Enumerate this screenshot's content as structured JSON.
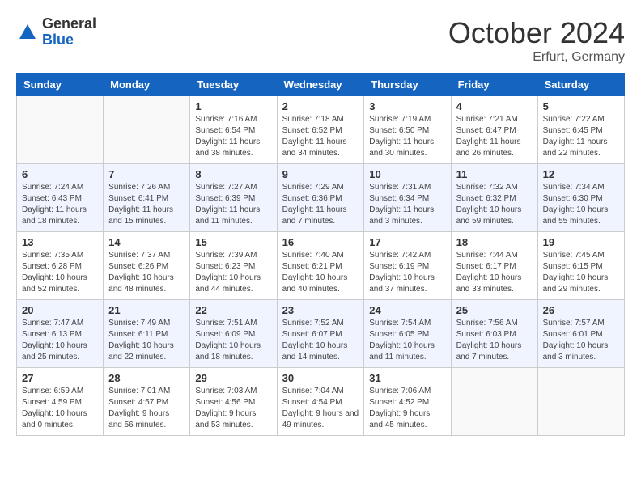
{
  "logo": {
    "general": "General",
    "blue": "Blue"
  },
  "header": {
    "month": "October 2024",
    "location": "Erfurt, Germany"
  },
  "weekdays": [
    "Sunday",
    "Monday",
    "Tuesday",
    "Wednesday",
    "Thursday",
    "Friday",
    "Saturday"
  ],
  "weeks": [
    [
      {
        "day": "",
        "info": ""
      },
      {
        "day": "",
        "info": ""
      },
      {
        "day": "1",
        "info": "Sunrise: 7:16 AM\nSunset: 6:54 PM\nDaylight: 11 hours and 38 minutes."
      },
      {
        "day": "2",
        "info": "Sunrise: 7:18 AM\nSunset: 6:52 PM\nDaylight: 11 hours and 34 minutes."
      },
      {
        "day": "3",
        "info": "Sunrise: 7:19 AM\nSunset: 6:50 PM\nDaylight: 11 hours and 30 minutes."
      },
      {
        "day": "4",
        "info": "Sunrise: 7:21 AM\nSunset: 6:47 PM\nDaylight: 11 hours and 26 minutes."
      },
      {
        "day": "5",
        "info": "Sunrise: 7:22 AM\nSunset: 6:45 PM\nDaylight: 11 hours and 22 minutes."
      }
    ],
    [
      {
        "day": "6",
        "info": "Sunrise: 7:24 AM\nSunset: 6:43 PM\nDaylight: 11 hours and 18 minutes."
      },
      {
        "day": "7",
        "info": "Sunrise: 7:26 AM\nSunset: 6:41 PM\nDaylight: 11 hours and 15 minutes."
      },
      {
        "day": "8",
        "info": "Sunrise: 7:27 AM\nSunset: 6:39 PM\nDaylight: 11 hours and 11 minutes."
      },
      {
        "day": "9",
        "info": "Sunrise: 7:29 AM\nSunset: 6:36 PM\nDaylight: 11 hours and 7 minutes."
      },
      {
        "day": "10",
        "info": "Sunrise: 7:31 AM\nSunset: 6:34 PM\nDaylight: 11 hours and 3 minutes."
      },
      {
        "day": "11",
        "info": "Sunrise: 7:32 AM\nSunset: 6:32 PM\nDaylight: 10 hours and 59 minutes."
      },
      {
        "day": "12",
        "info": "Sunrise: 7:34 AM\nSunset: 6:30 PM\nDaylight: 10 hours and 55 minutes."
      }
    ],
    [
      {
        "day": "13",
        "info": "Sunrise: 7:35 AM\nSunset: 6:28 PM\nDaylight: 10 hours and 52 minutes."
      },
      {
        "day": "14",
        "info": "Sunrise: 7:37 AM\nSunset: 6:26 PM\nDaylight: 10 hours and 48 minutes."
      },
      {
        "day": "15",
        "info": "Sunrise: 7:39 AM\nSunset: 6:23 PM\nDaylight: 10 hours and 44 minutes."
      },
      {
        "day": "16",
        "info": "Sunrise: 7:40 AM\nSunset: 6:21 PM\nDaylight: 10 hours and 40 minutes."
      },
      {
        "day": "17",
        "info": "Sunrise: 7:42 AM\nSunset: 6:19 PM\nDaylight: 10 hours and 37 minutes."
      },
      {
        "day": "18",
        "info": "Sunrise: 7:44 AM\nSunset: 6:17 PM\nDaylight: 10 hours and 33 minutes."
      },
      {
        "day": "19",
        "info": "Sunrise: 7:45 AM\nSunset: 6:15 PM\nDaylight: 10 hours and 29 minutes."
      }
    ],
    [
      {
        "day": "20",
        "info": "Sunrise: 7:47 AM\nSunset: 6:13 PM\nDaylight: 10 hours and 25 minutes."
      },
      {
        "day": "21",
        "info": "Sunrise: 7:49 AM\nSunset: 6:11 PM\nDaylight: 10 hours and 22 minutes."
      },
      {
        "day": "22",
        "info": "Sunrise: 7:51 AM\nSunset: 6:09 PM\nDaylight: 10 hours and 18 minutes."
      },
      {
        "day": "23",
        "info": "Sunrise: 7:52 AM\nSunset: 6:07 PM\nDaylight: 10 hours and 14 minutes."
      },
      {
        "day": "24",
        "info": "Sunrise: 7:54 AM\nSunset: 6:05 PM\nDaylight: 10 hours and 11 minutes."
      },
      {
        "day": "25",
        "info": "Sunrise: 7:56 AM\nSunset: 6:03 PM\nDaylight: 10 hours and 7 minutes."
      },
      {
        "day": "26",
        "info": "Sunrise: 7:57 AM\nSunset: 6:01 PM\nDaylight: 10 hours and 3 minutes."
      }
    ],
    [
      {
        "day": "27",
        "info": "Sunrise: 6:59 AM\nSunset: 4:59 PM\nDaylight: 10 hours and 0 minutes."
      },
      {
        "day": "28",
        "info": "Sunrise: 7:01 AM\nSunset: 4:57 PM\nDaylight: 9 hours and 56 minutes."
      },
      {
        "day": "29",
        "info": "Sunrise: 7:03 AM\nSunset: 4:56 PM\nDaylight: 9 hours and 53 minutes."
      },
      {
        "day": "30",
        "info": "Sunrise: 7:04 AM\nSunset: 4:54 PM\nDaylight: 9 hours and 49 minutes."
      },
      {
        "day": "31",
        "info": "Sunrise: 7:06 AM\nSunset: 4:52 PM\nDaylight: 9 hours and 45 minutes."
      },
      {
        "day": "",
        "info": ""
      },
      {
        "day": "",
        "info": ""
      }
    ]
  ]
}
